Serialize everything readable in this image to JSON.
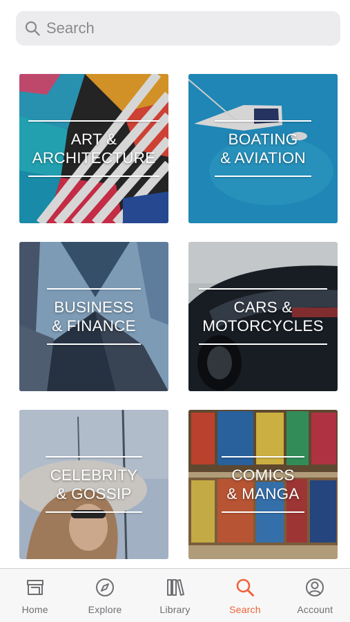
{
  "search": {
    "placeholder": "Search"
  },
  "categories": [
    {
      "label": "ART &\nARCHITECTURE"
    },
    {
      "label": "BOATING\n& AVIATION"
    },
    {
      "label": "BUSINESS\n& FINANCE"
    },
    {
      "label": "CARS &\nMOTORCYCLES"
    },
    {
      "label": "CELEBRITY\n& GOSSIP"
    },
    {
      "label": "COMICS\n& MANGA"
    }
  ],
  "tabs": [
    {
      "label": "Home",
      "icon": "store-icon",
      "active": false
    },
    {
      "label": "Explore",
      "icon": "compass-icon",
      "active": false
    },
    {
      "label": "Library",
      "icon": "library-icon",
      "active": false
    },
    {
      "label": "Search",
      "icon": "search-icon",
      "active": true
    },
    {
      "label": "Account",
      "icon": "account-icon",
      "active": false
    }
  ],
  "colors": {
    "accent": "#f0613a",
    "inactive": "#6e6e73"
  }
}
